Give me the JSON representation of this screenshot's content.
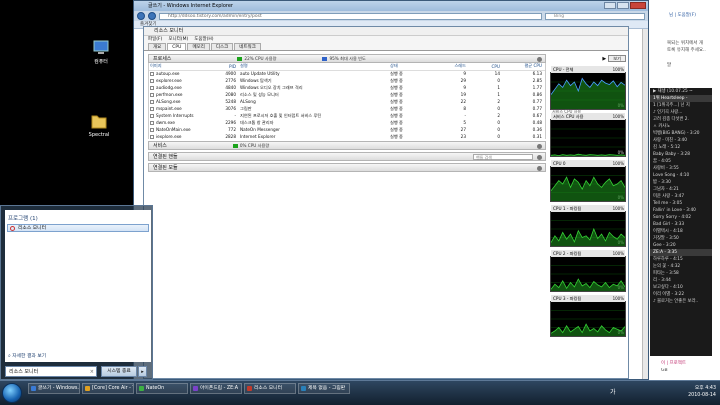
{
  "desktop": {
    "icons": [
      {
        "label": "컴퓨터",
        "icon": "computer-icon"
      },
      {
        "label": "Spectral",
        "icon": "folder-icon"
      }
    ]
  },
  "ie": {
    "title": "글쓰기 - Windows Internet Explorer",
    "url": "http://ddsoo.tistory.com/admin/entry/post",
    "search_placeholder": "Bing",
    "favorites": "즐겨찾기"
  },
  "resmon": {
    "title": "리소스 모니터",
    "menu": [
      "파일(F)",
      "모니터(M)",
      "도움말(H)"
    ],
    "tabs": [
      "개요",
      "CPU",
      "메모리",
      "디스크",
      "네트워크"
    ],
    "active_tab": "CPU",
    "processes": {
      "header": "프로세스",
      "cpu_usage": "22% CPU 사용량",
      "max_freq": "95% 최대 사용 빈도",
      "columns": [
        "이미지",
        "PID",
        "설명",
        "상태",
        "스레드",
        "CPU",
        "평균 CPU"
      ],
      "rows": [
        [
          "autoup.exe",
          "4900",
          "auto Update Utility",
          "실행 중",
          "9",
          "14",
          "6.13"
        ],
        [
          "explorer.exe",
          "2776",
          "Windows 탐색기",
          "실행 중",
          "29",
          "0",
          "2.85"
        ],
        [
          "audiodg.exe",
          "4840",
          "Windows 오디오 장치 그래프 격리",
          "실행 중",
          "9",
          "1",
          "1.77"
        ],
        [
          "perfmon.exe",
          "2080",
          "리소스 및 성능 모니터",
          "실행 중",
          "19",
          "1",
          "0.86"
        ],
        [
          "ALSong.exe",
          "5248",
          "ALSong",
          "실행 중",
          "22",
          "2",
          "0.77"
        ],
        [
          "mspaint.exe",
          "3076",
          "그림판",
          "실행 중",
          "8",
          "0",
          "0.77"
        ],
        [
          "System Interrupts",
          "-",
          "지연된 프로시저 호출 및 인터럽트 서비스 루틴",
          "실행 중",
          "-",
          "2",
          "0.67"
        ],
        [
          "dwm.exe",
          "2296",
          "데스크톱 창 관리자",
          "실행 중",
          "5",
          "0",
          "0.48"
        ],
        [
          "NateOnMain.exe",
          "772",
          "NateOn Messenger",
          "실행 중",
          "27",
          "0",
          "0.36"
        ],
        [
          "iexplore.exe",
          "2828",
          "Internet Explorer",
          "실행 중",
          "23",
          "0",
          "0.31"
        ]
      ]
    },
    "services": {
      "header": "서비스",
      "cpu_usage": "0% CPU 사용량"
    },
    "handles": {
      "header": "연결된 핸들",
      "filter_placeholder": "핸들 검색"
    },
    "modules": {
      "header": "연결된 모듈"
    },
    "view_button": "보기",
    "graphs": [
      {
        "label": "CPU - 전체",
        "top": "100%",
        "bottom": "0%",
        "sub": "서비스 CPU 사용",
        "values": [
          40,
          55,
          70,
          60,
          80,
          65,
          75,
          50,
          85,
          70,
          60,
          75,
          65,
          80,
          72,
          68,
          78,
          62,
          74,
          66
        ]
      },
      {
        "label": "서비스 CPU 사용",
        "top": "100%",
        "bottom": "0%",
        "sub": "",
        "values": [
          2,
          3,
          1,
          4,
          2,
          3,
          2,
          5,
          3,
          2,
          4,
          3,
          2,
          3,
          2,
          4,
          3,
          2,
          3,
          2
        ]
      },
      {
        "label": "CPU 0",
        "top": "100%",
        "bottom": "0%",
        "sub": "",
        "values": [
          30,
          45,
          60,
          50,
          70,
          40,
          65,
          55,
          35,
          60,
          45,
          70,
          50,
          40,
          55,
          65,
          45,
          50,
          60,
          40
        ]
      },
      {
        "label": "CPU 1 - 파킹됨",
        "top": "100%",
        "bottom": "0%",
        "sub": "",
        "values": [
          10,
          30,
          15,
          40,
          20,
          35,
          12,
          45,
          25,
          30,
          18,
          50,
          22,
          35,
          15,
          40,
          28,
          20,
          35,
          25
        ]
      },
      {
        "label": "CPU 2 - 파킹됨",
        "top": "100%",
        "bottom": "0%",
        "sub": "",
        "values": [
          5,
          20,
          10,
          30,
          8,
          25,
          12,
          35,
          15,
          22,
          10,
          28,
          18,
          12,
          25,
          10,
          20,
          15,
          30,
          12
        ]
      },
      {
        "label": "CPU 3 - 파킹됨",
        "top": "100%",
        "bottom": "0%",
        "sub": "",
        "values": [
          8,
          15,
          25,
          10,
          30,
          12,
          20,
          28,
          10,
          35,
          15,
          22,
          12,
          30,
          18,
          10,
          25,
          20,
          15,
          28
        ]
      }
    ]
  },
  "bgright": {
    "lines": [
      "님 | 도움말(F)",
      "복되는 위치에서 개",
      "토록 유지해 주세요..",
      "말"
    ],
    "music": [
      "▶ 재생 (10.07.25 ~",
      "1위 Heartsleep -",
      "1 [1위곡주...] 넌 지",
      "♪ 인기곡 사랑...",
      "고려 김종 다섯번 2.",
      "ㅅ 카사노",
      "빅뱅(BIG BANG) - 3:20",
      "사랑 - 미친 - 3:40",
      "김 노래 - 5:12",
      "Baby Baby - 3:28",
      "꿈 - 4:05",
      "사랑비 - 3:55",
      "Love Song - 4:10",
      "밥 - 3:30",
      "그남자 - 4:21",
      "미운 사랑 - 3:47",
      "Tell me - 3:05",
      "Fallin' in Love - 3:40",
      "Sorry Sorry - 4:02",
      "Bad Girl - 3:33",
      "이별택시 - 4:18",
      "거짓말 - 3:50",
      "Gee - 3:20",
      "ZE:A - 3:35",
      "하루하루 - 4:15",
      "눈의 꽃 - 4:32",
      "피타는 - 3:58",
      "리 - 3:44",
      "보고싶다 - 4:10",
      "이리 이별 - 3:22",
      "♪ 블로거는 안좋은 보라.."
    ],
    "ad_top": "이 | 프로젝트",
    "ad_bottom": "GB"
  },
  "start_menu": {
    "group_title": "프로그램 (1)",
    "result": "리소스 모니터",
    "more_results": "자세한 결과 보기",
    "search_value": "리소스 모니터",
    "shutdown_label": "시스템 종료"
  },
  "taskbar": {
    "items": [
      {
        "label": "글쓰기 - Windows...",
        "color": "#3a7bd5"
      },
      {
        "label": "[Core] Core Air - Tra...",
        "color": "#e0a020"
      },
      {
        "label": "NateOn",
        "color": "#3cb043"
      },
      {
        "label": "아이폰드립 - ZE:A",
        "color": "#7a42c9"
      },
      {
        "label": "리소스 모니터",
        "color": "#c0392b"
      },
      {
        "label": "제목 없음 - 그림판",
        "color": "#2980b9"
      }
    ],
    "lang": "가",
    "time": "오후 4:43",
    "date": "2010-08-14"
  }
}
